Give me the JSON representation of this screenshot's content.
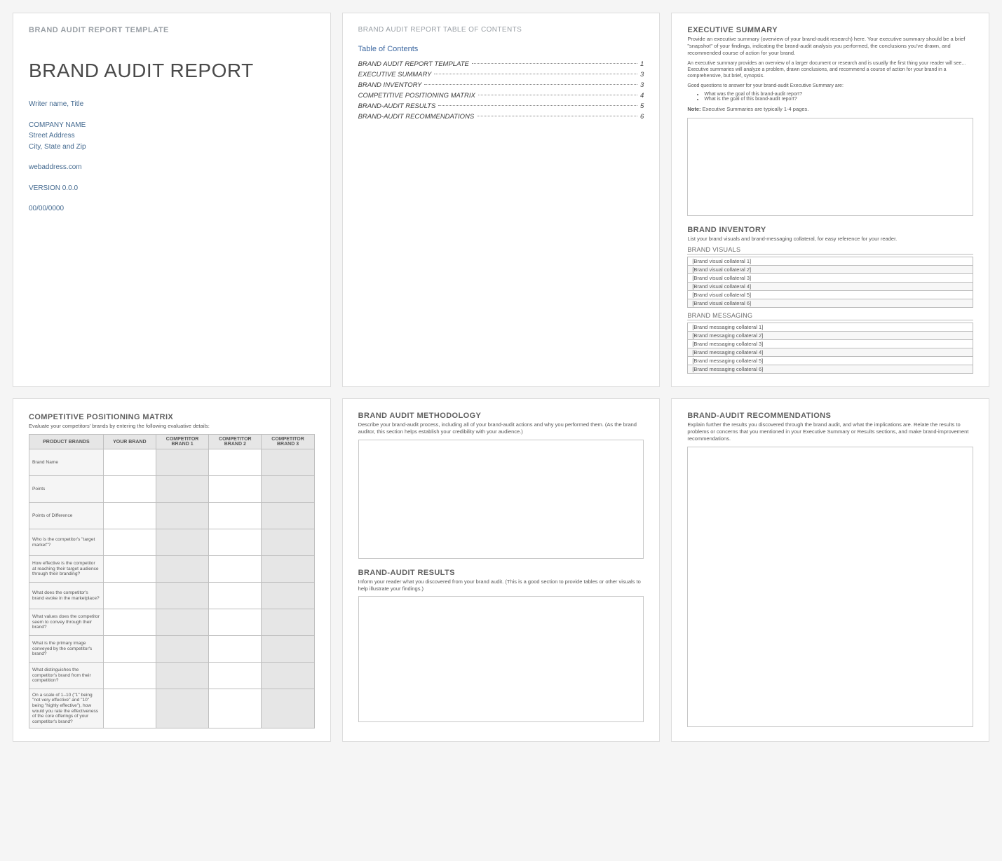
{
  "p1": {
    "header": "BRAND AUDIT REPORT TEMPLATE",
    "title": "BRAND AUDIT REPORT",
    "writer": "Writer name, Title",
    "company": "COMPANY NAME",
    "street": "Street Address",
    "citystate": "City, State and Zip",
    "web": "webaddress.com",
    "version": "VERSION 0.0.0",
    "date": "00/00/0000"
  },
  "p2": {
    "header": "BRAND AUDIT REPORT TABLE OF CONTENTS",
    "toc_title": "Table of Contents",
    "items": [
      {
        "label": "BRAND AUDIT REPORT TEMPLATE",
        "page": "1"
      },
      {
        "label": "EXECUTIVE SUMMARY",
        "page": "3"
      },
      {
        "label": "BRAND INVENTORY",
        "page": "3"
      },
      {
        "label": "COMPETITIVE POSITIONING MATRIX",
        "page": "4"
      },
      {
        "label": "BRAND-AUDIT RESULTS",
        "page": "5"
      },
      {
        "label": "BRAND-AUDIT RECOMMENDATIONS",
        "page": "6"
      }
    ]
  },
  "p3": {
    "exec_title": "EXECUTIVE SUMMARY",
    "exec_sub": "Provide an executive summary (overview of your brand-audit research) here. Your executive summary should be a brief \"snapshot\" of your findings, indicating the brand-audit analysis you performed, the conclusions you've drawn, and recommended course of action for your brand.",
    "exec_para": "An executive summary provides an overview of a larger document or research and is usually the first thing your reader will see... Executive summaries will analyze a problem, drawn conclusions, and recommend a course of action for your brand in a comprehensive, but brief, synopsis.",
    "exec_q_intro": "Good questions to answer for your brand-audit Executive Summary are:",
    "exec_bul1": "What was the goal of this brand-audit report?",
    "exec_bul2": "What is the goal of this brand-audit report?",
    "note_label": "Note:",
    "note_text": "Executive Summaries are typically 1-4 pages.",
    "inv_title": "BRAND INVENTORY",
    "inv_sub": "List your brand visuals and brand-messaging collateral, for easy reference for your reader.",
    "visuals_title": "BRAND VISUALS",
    "visuals": [
      "[Brand visual collateral 1]",
      "[Brand visual collateral 2]",
      "[Brand visual collateral 3]",
      "[Brand visual collateral 4]",
      "[Brand visual collateral 5]",
      "[Brand visual collateral 6]"
    ],
    "messaging_title": "BRAND MESSAGING",
    "messaging": [
      "[Brand messaging collateral 1]",
      "[Brand messaging collateral 2]",
      "[Brand messaging collateral 3]",
      "[Brand messaging collateral 4]",
      "[Brand messaging collateral 5]",
      "[Brand messaging collateral 6]"
    ]
  },
  "p4": {
    "title": "COMPETITIVE POSITIONING MATRIX",
    "sub": "Evaluate your competitors' brands by entering the following evaluative details:",
    "h1": "PRODUCT BRANDS",
    "h2": "YOUR BRAND",
    "h3": "COMPETITOR BRAND 1",
    "h4": "COMPETITOR BRAND 2",
    "h5": "COMPETITOR BRAND 3",
    "rows": [
      "Brand Name",
      "Points",
      "Points of Difference",
      "Who is the competitor's \"target market\"?",
      "How effective is the competitor at reaching their target audience through their branding?",
      "What does the competitor's brand evoke in the marketplace?",
      "What values does the competitor seem to convey through their brand?",
      "What is the primary image conveyed by the competitor's brand?",
      "What distinguishes the competitor's brand from their competition?",
      "On a scale of 1–10 (\"1\" being \"not very effective\" and \"10\" being \"highly effective\"), how would you rate the effectiveness of the core offerings of your competitor's brand?"
    ]
  },
  "p5": {
    "meth_title": "BRAND AUDIT METHODOLOGY",
    "meth_sub": "Describe your brand-audit process, including all of your brand-audit actions and why you performed them. (As the brand auditor, this section helps establish your credibility with your audience.)",
    "res_title": "BRAND-AUDIT RESULTS",
    "res_sub": "Inform your reader what you discovered from your brand audit. (This is a good section to provide tables or other visuals to help illustrate your findings.)"
  },
  "p6": {
    "title": "BRAND-AUDIT RECOMMENDATIONS",
    "sub": "Explain further the results you discovered through the brand audit, and what the implications are. Relate the results to problems or concerns that you mentioned in your Executive Summary or Results sections, and make brand-improvement recommendations."
  }
}
